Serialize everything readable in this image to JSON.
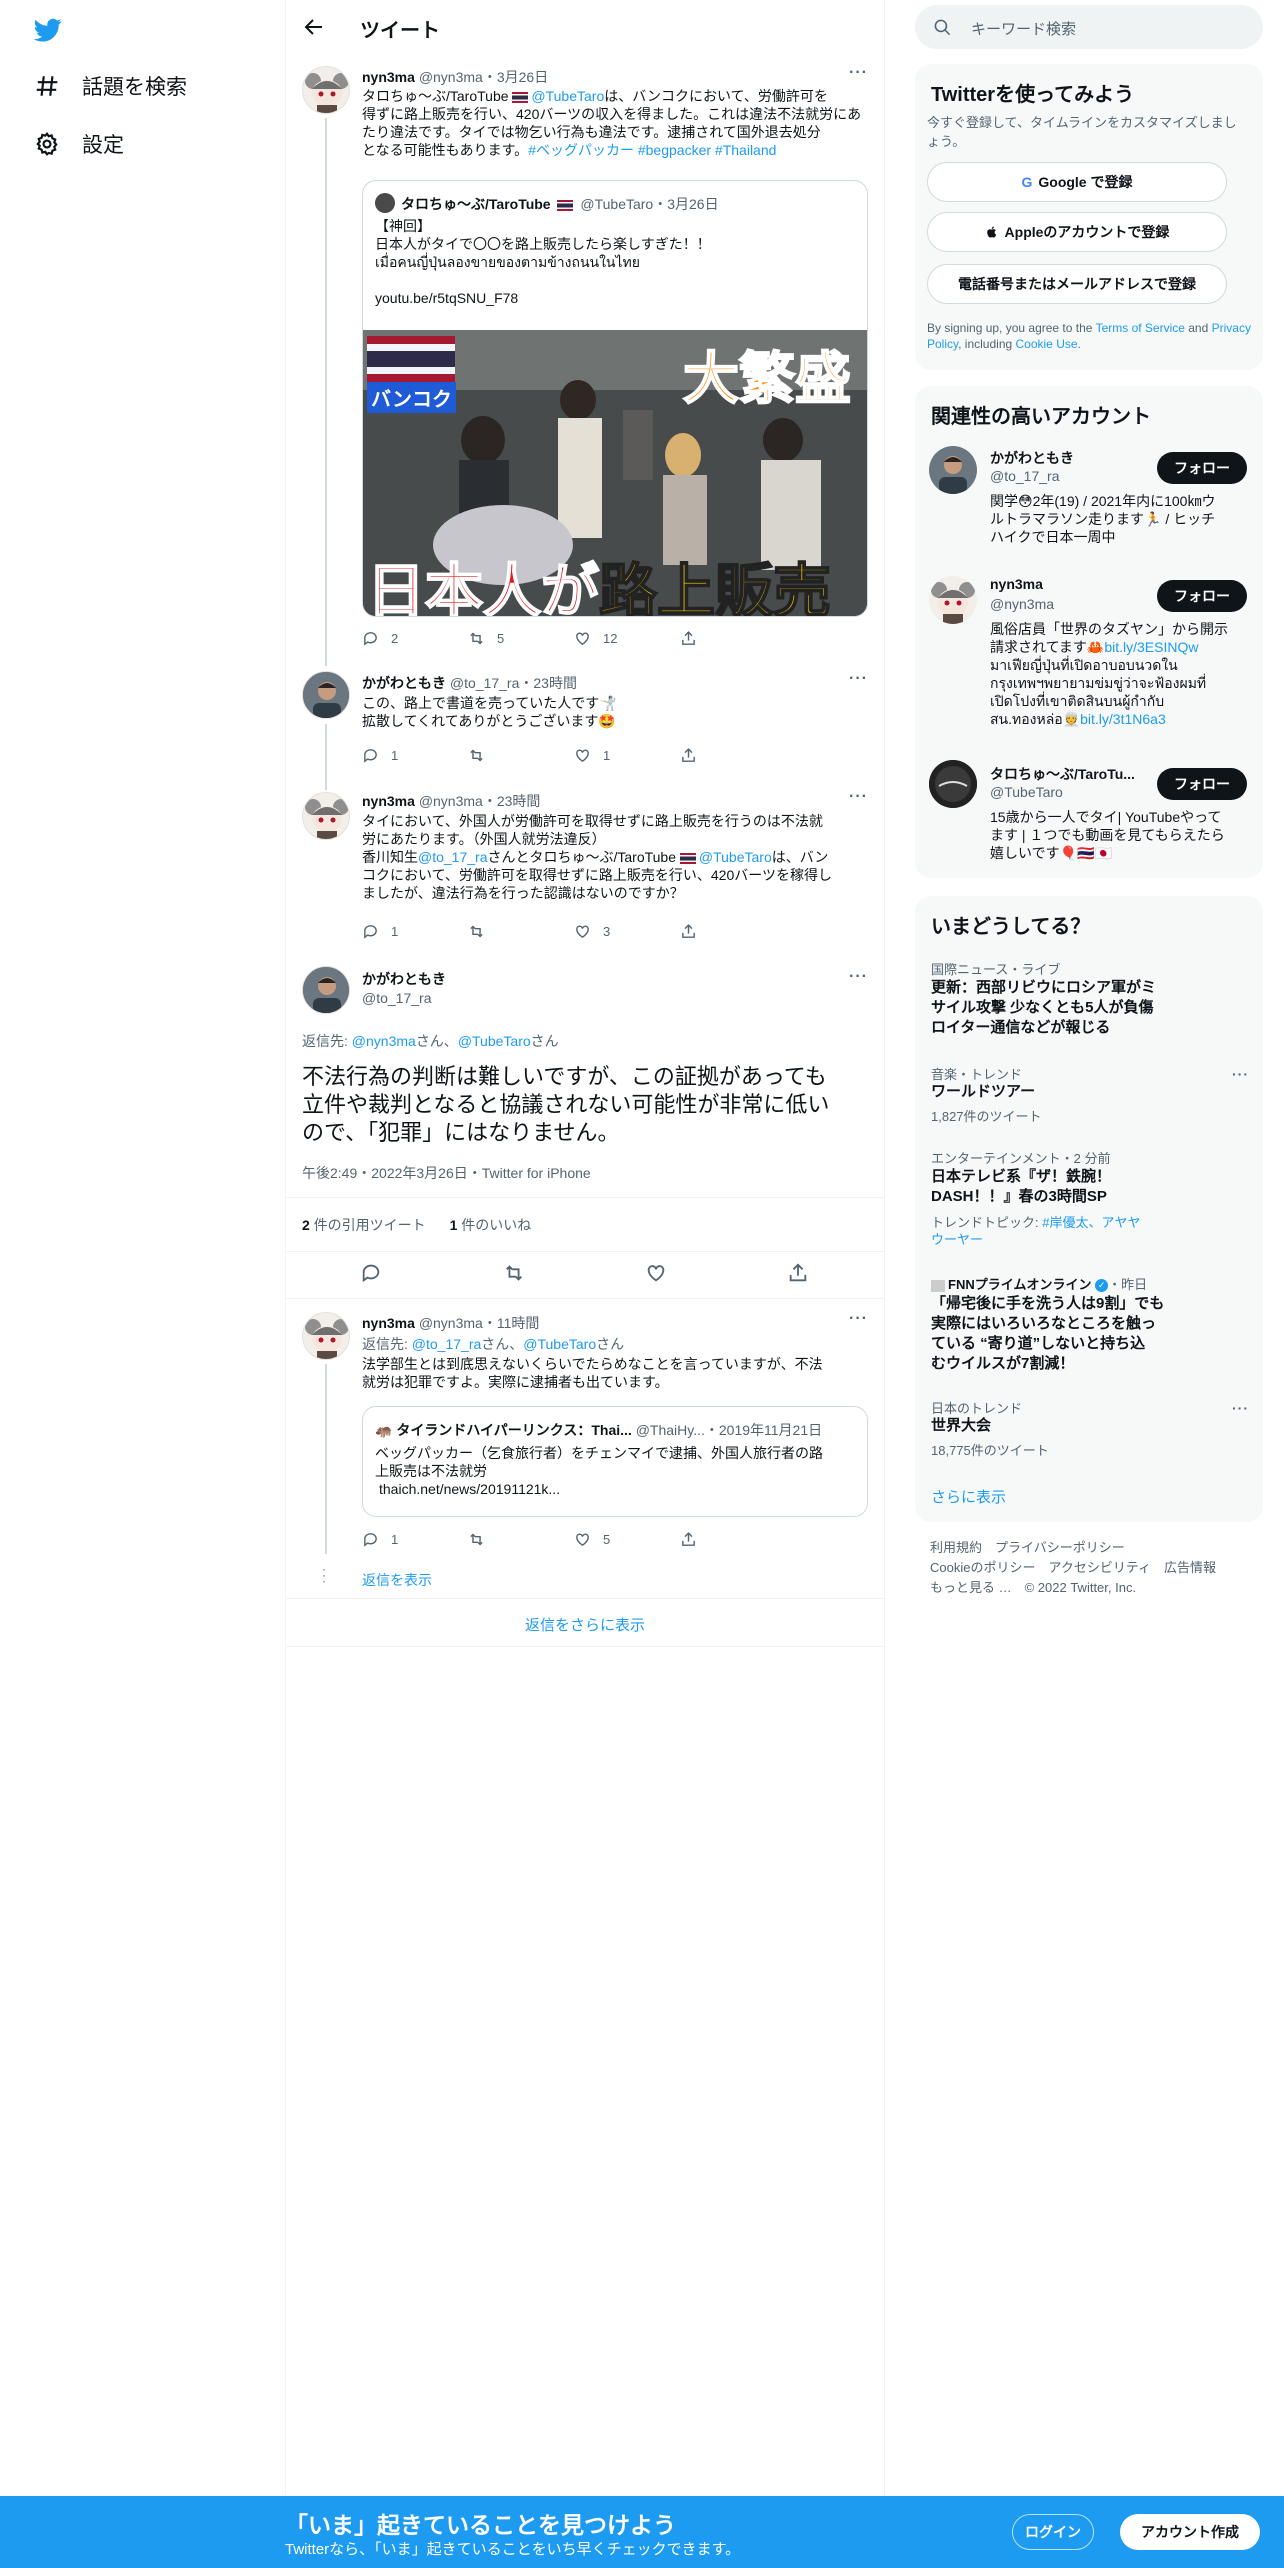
{
  "nav": {
    "explore": "話題を検索",
    "settings": "設定"
  },
  "header": {
    "title": "ツイート"
  },
  "t1": {
    "name": "nyn3ma",
    "handle": "@nyn3ma",
    "time": "・3月26日",
    "l1a": "タロちゅ〜ぶ/TaroTube ",
    "l1b": "@TubeTaro",
    "l1c": "は、バンコクにおいて、労働許可を",
    "l2": "得ずに路上販売を行い、420バーツの収入を得ました。これは違法不法就労にあ",
    "l3": "たり違法です。タイでは物乞い行為も違法です。逮捕されて国外退去処分",
    "l4a": "となる可能性もあります。",
    "l4b": "#ベッグパッカー #begpacker #Thailand",
    "q_name": "タロちゅ〜ぶ/TaroTube",
    "q_handle": "@TubeTaro・3月26日",
    "q_l1": "【神回】",
    "q_l2": "日本人がタイで〇〇を路上販売したら楽しすぎた！！",
    "q_l3": "เมื่อคนญี่ปุ่นลองขายของตามข้างถนนในไทย",
    "q_l4": "youtu.be/r5tqSNU_F78",
    "img_bangkok": "バンコク",
    "img_big": "大繁盛",
    "img_bottom_a": "日本人が",
    "img_bottom_b": "路上販売",
    "replies": "2",
    "retweets": "5",
    "likes": "12"
  },
  "t2": {
    "name": "かがわともき",
    "handle": "@to_17_ra",
    "time": "・23時間",
    "l1": "この、路上で書道を売っていた人です🤺",
    "l2": "拡散してくれてありがとうございます🤩",
    "replies": "1",
    "likes": "1"
  },
  "t3": {
    "name": "nyn3ma",
    "handle": "@nyn3ma",
    "time": "・23時間",
    "l1": "タイにおいて、外国人が労働許可を取得せずに路上販売を行うのは不法就",
    "l2": "労にあたります。（外国人就労法違反）",
    "l3a": "香川知生",
    "l3b": "@to_17_ra",
    "l3c": "さんとタロちゅ〜ぶ/TaroTube ",
    "l3d": "@TubeTaro",
    "l3e": "は、バン",
    "l4": "コクにおいて、労働許可を取得せずに路上販売を行い、420バーツを稼得し",
    "l5": "ましたが、違法行為を行った認識はないのですか？",
    "replies": "1",
    "likes": "3"
  },
  "focus": {
    "name": "かがわともき",
    "handle": "@to_17_ra",
    "reply_to_label": "返信先: ",
    "reply_a": "@nyn3ma",
    "reply_mid": "さん、",
    "reply_b": "@TubeTaro",
    "reply_end": "さん",
    "l1": "不法行為の判断は難しいですが、この証拠があっても",
    "l2": "立件や裁判となると協議されない可能性が非常に低い",
    "l3": "ので、「犯罪」にはなりません。",
    "meta": "午後2:49・2022年3月26日・Twitter for iPhone",
    "quote_count": "2",
    "quote_label": " 件の引用ツイート",
    "like_count": "1",
    "like_label": " 件のいいね"
  },
  "t4": {
    "name": "nyn3ma",
    "handle": "@nyn3ma",
    "time": "・11時間",
    "reply_label": "返信先: ",
    "reply_a": "@to_17_ra",
    "reply_mid": "さん、",
    "reply_b": "@TubeTaro",
    "reply_end": "さん",
    "l1": "法学部生とは到底思えないくらいでたらめなことを言っていますが、不法",
    "l2": "就労は犯罪ですよ。実際に逮捕者も出ています。",
    "q_name": "タイランドハイパーリンクス：Thai...",
    "q_handle": "@ThaiHy...",
    "q_time": "・2019年11月21日",
    "q_l1": "ベッグパッカー（乞食旅行者）をチェンマイで逮捕、外国人旅行者の路",
    "q_l2": "上販売は不法就労",
    "q_l3": "thaich.net/news/20191121k...",
    "replies": "1",
    "likes": "5",
    "show_replies": "返信を表示"
  },
  "more_replies": "返信をさらに表示",
  "search": {
    "placeholder": "キーワード検索"
  },
  "signup": {
    "title": "Twitterを使ってみよう",
    "subtitle": "今すぐ登録して、タイムラインをカスタマイズしましょう。",
    "google": "Google で登録",
    "apple": "Appleのアカウントで登録",
    "phone": "電話番号またはメールアドレスで登録",
    "legal_a": "By signing up, you agree to the ",
    "terms": "Terms of Service",
    "legal_b": " and",
    "privacy": "Privacy Policy",
    "legal_c": ", including ",
    "cookie": "Cookie Use",
    "legal_d": "."
  },
  "related": {
    "title": "関連性の高いアカウント",
    "follow": "フォロー",
    "a1_name": "かがわともき",
    "a1_handle": "@to_17_ra",
    "a1_b1": "関学😳2年(19) / 2021年内に100㎞ウ",
    "a1_b2": "ルトラマラソン走ります🏃 / ヒッチ",
    "a1_b3": "ハイクで日本一周中",
    "a2_name": "nyn3ma",
    "a2_handle": "@nyn3ma",
    "a2_b1": "風俗店員「世界のタズヤン」から開示",
    "a2_b2a": "請求されてます🦀",
    "a2_b2b": "bit.ly/3ESINQw",
    "a2_b3": "มาเฟียญี่ปุ่นที่เปิดอาบอบนวดใน",
    "a2_b4": "กรุงเทพฯพยายามข่มขู่ว่าจะฟ้องผมที่",
    "a2_b5": "เปิดโปงที่เขาติดสินบนผู้กำกับ",
    "a2_b6a": "สน.ทองหล่อ👳",
    "a2_b6b": "bit.ly/3t1N6a3",
    "a3_name": "タロちゅ〜ぶ/TaroTu...",
    "a3_handle": "@TubeTaro",
    "a3_b1": "15歳から一人でタイ| YouTubeやって",
    "a3_b2": "ます | １つでも動画を見てもらえたら",
    "a3_b3": "嬉しいです🎈🇹🇭🇯🇵"
  },
  "trends": {
    "title": "いまどうしてる？",
    "t1_meta": "国際ニュース・ライブ",
    "t1_l1": "更新：西部リビウにロシア軍がミ",
    "t1_l2": "サイル攻撃 少なくとも5人が負傷",
    "t1_l3": "ロイター通信などが報じる",
    "t2_meta": "音楽・トレンド",
    "t2_title": "ワールドツアー",
    "t2_count": "1,827件のツイート",
    "t3_meta": "エンターテインメント・2 分前",
    "t3_l1": "日本テレビ系『ザ！鉄腕！",
    "t3_l2": "DASH！！』春の3時間SP",
    "t3_topic_label": "トレンドトピック: ",
    "t3_topic_a": "#岸優太、アヤヤ",
    "t3_topic_b": "ウーヤー",
    "t4_source": "FNNプライムオンライン",
    "t4_time": "・昨日",
    "t4_l1": "「帰宅後に手を洗う人は9割」でも",
    "t4_l2": "実際にはいろいろなところを触っ",
    "t4_l3": "ている “寄り道”しないと持ち込",
    "t4_l4": "むウイルスが7割減！",
    "t5_meta": "日本のトレンド",
    "t5_title": "世界大会",
    "t5_count": "18,775件のツイート",
    "show_more": "さらに表示"
  },
  "footer": {
    "l1": "利用規約　プライバシーポリシー",
    "l2": "Cookieのポリシー　アクセシビリティ　広告情報",
    "l3": "もっと見る …　© 2022 Twitter, Inc."
  },
  "bottom": {
    "title": "「いま」起きていることを見つけよう",
    "subtitle": "Twitterなら、「いま」起きていることをいち早くチェックできます。",
    "login": "ログイン",
    "signup": "アカウント作成"
  },
  "colors": {
    "accent": "#1d9bf0",
    "text": "#0f1419",
    "secondary": "#536471"
  }
}
